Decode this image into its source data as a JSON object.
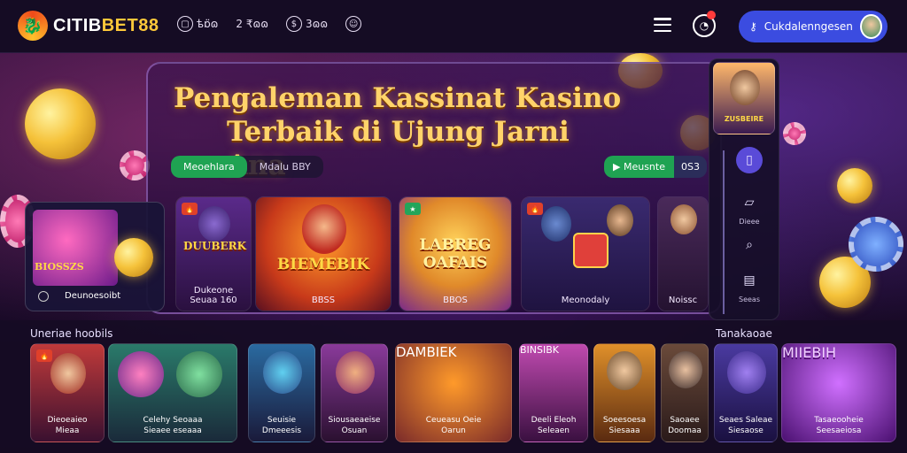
{
  "brand": {
    "part1": "CITIB",
    "part2": "BET88"
  },
  "topnav": [
    {
      "icon": "phone-icon",
      "label": "ѣɒ̈ɷ"
    },
    {
      "icon": "gift-icon",
      "label": "2 ₹ɷɷ"
    },
    {
      "icon": "dollar-icon",
      "label": "3ɷɷ"
    },
    {
      "icon": "user-icon",
      "label": ""
    }
  ],
  "login": {
    "label": "Cukdalenngesen"
  },
  "hero": {
    "line1": "Pengaleman Kassinat Kasino",
    "line2": "Terbaik di Ujung Jarni Ana"
  },
  "tabs": [
    {
      "label": "Meoehlara",
      "active": true
    },
    {
      "label": "Mdalu BBY",
      "active": false
    }
  ],
  "action": {
    "green": "Meusnte",
    "dark": "0S3"
  },
  "hero_cards": [
    {
      "title": "DUUBERK",
      "name": "Dukeone\nSeuaa 160"
    },
    {
      "title": "BIEMEBIK",
      "name": "BBSS"
    },
    {
      "title": "LABREG\nOAFAIS",
      "name": "BBOS"
    },
    {
      "title": "",
      "name": "Meonodaly"
    },
    {
      "title": "",
      "name": "Noissc"
    }
  ],
  "left_promo": {
    "title": "BIOSSZS",
    "label": "Deunoesoibt"
  },
  "side_panel": {
    "thumb_label": "ZUSBEIRE",
    "items": [
      {
        "icon": "clipboard-icon",
        "label": ""
      },
      {
        "icon": "box-icon",
        "label": "Dieee"
      },
      {
        "icon": "search-icon",
        "label": ""
      },
      {
        "icon": "book-icon",
        "label": "Seeas"
      }
    ]
  },
  "sections": {
    "left": "Uneriae hoobils",
    "right": "Tanakaoae"
  },
  "bottom_cards": [
    {
      "cap1": "Dieoeaieo",
      "cap2": "Mieaa"
    },
    {
      "cap1": "Celehy Seoaaa",
      "cap2": "Sieaee eseaaa"
    },
    {
      "cap1": "Seuisie",
      "cap2": "Dmeeesis"
    },
    {
      "cap1": "Siousaeaeise",
      "cap2": "Osuan"
    },
    {
      "cap1": "Ceueasu Oeie",
      "cap2": "Oarun",
      "title": "DAMBIEK"
    },
    {
      "cap1": "Deeli Eleoh",
      "cap2": "Seleaen",
      "title": "BINSIBK"
    },
    {
      "cap1": "Soeesoesa",
      "cap2": "Siesaaa"
    },
    {
      "cap1": "Saoaee",
      "cap2": "Doomaa"
    },
    {
      "cap1": "Seaes Saleae",
      "cap2": "Siesaose"
    },
    {
      "cap1": "Tasaeooheie",
      "cap2": "Seesaeiosa",
      "title": "MIIEBIH"
    }
  ],
  "colors": {
    "accent_green": "#1fa352",
    "login_blue": "#3b4ce0",
    "gold": "#ffd36a"
  }
}
